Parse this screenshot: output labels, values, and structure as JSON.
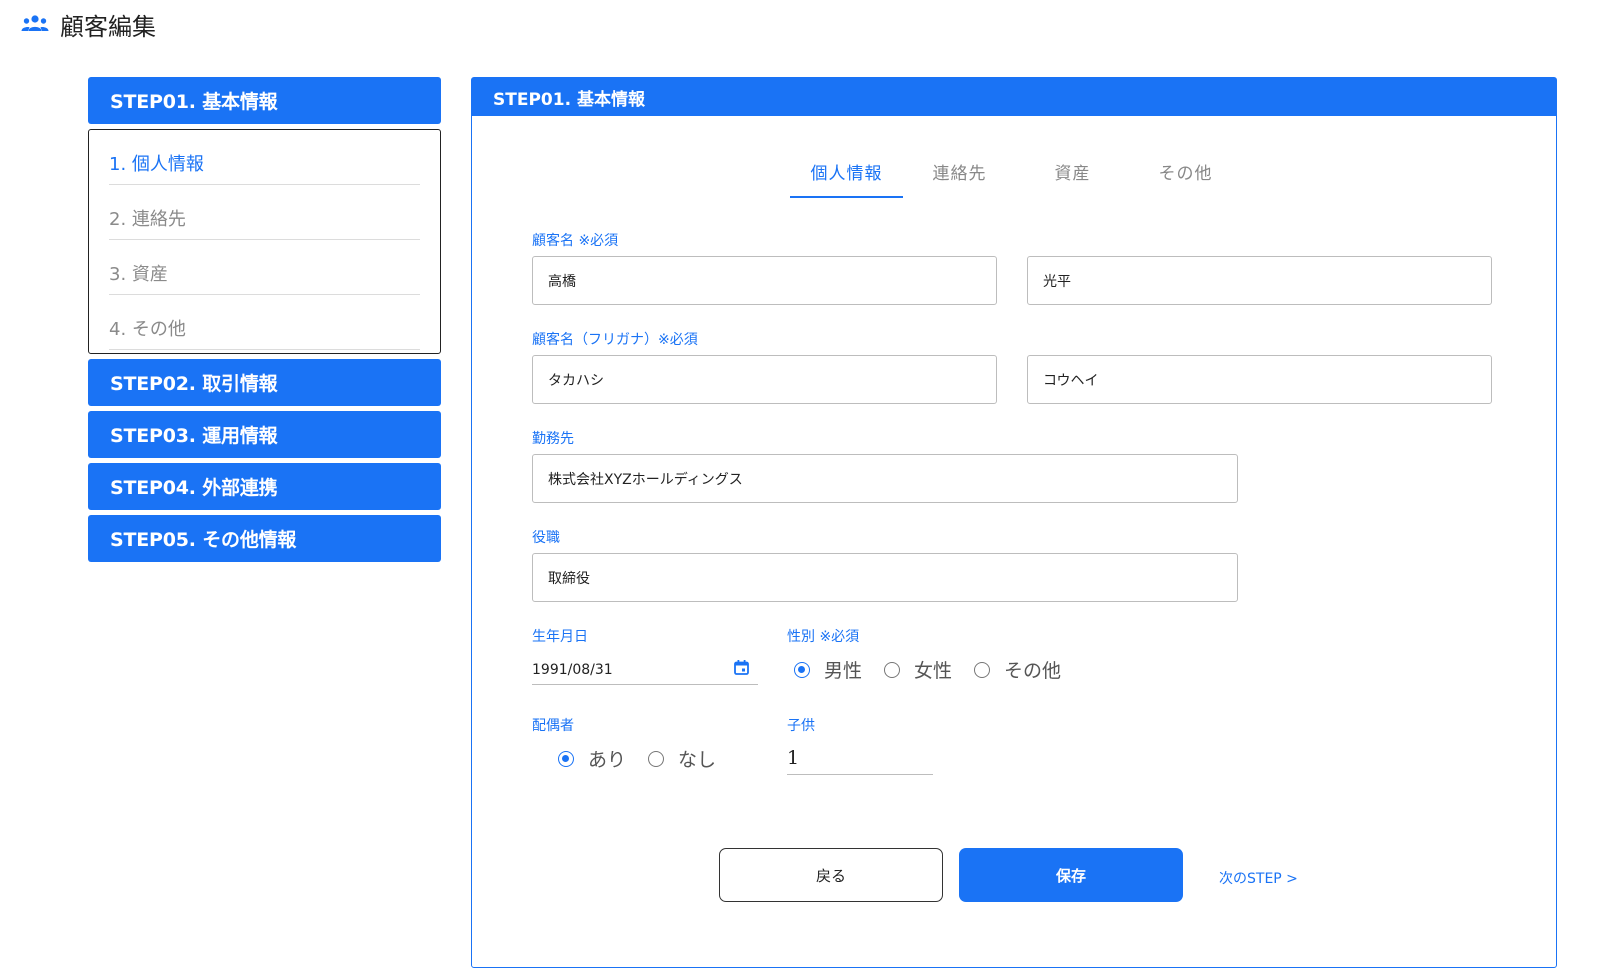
{
  "page": {
    "title": "顧客編集",
    "icon": "people-icon"
  },
  "sidebar": {
    "steps": [
      {
        "label": "STEP01. 基本情報"
      },
      {
        "label": "STEP02. 取引情報"
      },
      {
        "label": "STEP03. 運用情報"
      },
      {
        "label": "STEP04. 外部連携"
      },
      {
        "label": "STEP05. その他情報"
      }
    ],
    "substeps": [
      {
        "label": "1. 個人情報",
        "active": true
      },
      {
        "label": "2. 連絡先",
        "active": false
      },
      {
        "label": "3. 資産",
        "active": false
      },
      {
        "label": "4. その他",
        "active": false
      }
    ]
  },
  "panel": {
    "header": "STEP01. 基本情報",
    "tabs": [
      {
        "label": "個人情報",
        "active": true
      },
      {
        "label": "連絡先",
        "active": false
      },
      {
        "label": "資産",
        "active": false
      },
      {
        "label": "その他",
        "active": false
      }
    ]
  },
  "form": {
    "name_label": "顧客名 ※必須",
    "last_name": "高橋",
    "first_name": "光平",
    "kana_label": "顧客名（フリガナ）※必須",
    "last_name_kana": "タカハシ",
    "first_name_kana": "コウヘイ",
    "employer_label": "勤務先",
    "employer": "株式会社XYZホールディングス",
    "position_label": "役職",
    "position": "取締役",
    "birthdate_label": "生年月日",
    "birthdate": "1991/08/31",
    "gender_label": "性別 ※必須",
    "gender_options": [
      "男性",
      "女性",
      "その他"
    ],
    "gender_selected": "男性",
    "spouse_label": "配偶者",
    "spouse_options": [
      "あり",
      "なし"
    ],
    "spouse_selected": "あり",
    "children_label": "子供",
    "children": "1"
  },
  "actions": {
    "back": "戻る",
    "save": "保存",
    "next": "次のSTEP >"
  },
  "colors": {
    "accent": "#1a73f5",
    "border": "#bdbdbd"
  }
}
